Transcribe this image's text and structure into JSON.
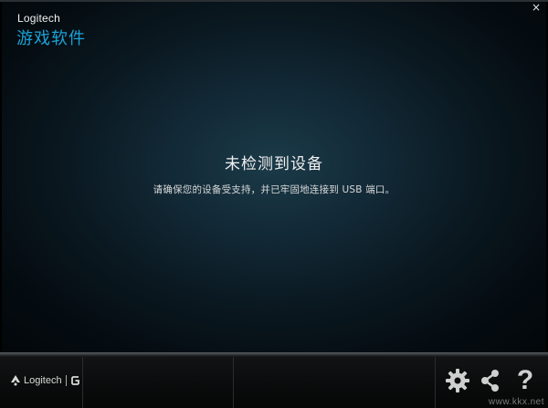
{
  "header": {
    "brand_name": "Logitech",
    "app_title": "游戏软件",
    "close_label": "×"
  },
  "message": {
    "title": "未检测到设备",
    "body": "请确保您的设备受支持，并已牢固地连接到 USB 端口。"
  },
  "footer": {
    "logo_text": "Logitech",
    "buttons": {
      "settings_icon": "gear-icon",
      "share_icon": "share-icon",
      "help_label": "?"
    }
  },
  "watermark": "www.kkx.net",
  "colors": {
    "accent": "#1aa3d8",
    "background": "#0a1820",
    "text": "#f0f0f0"
  }
}
